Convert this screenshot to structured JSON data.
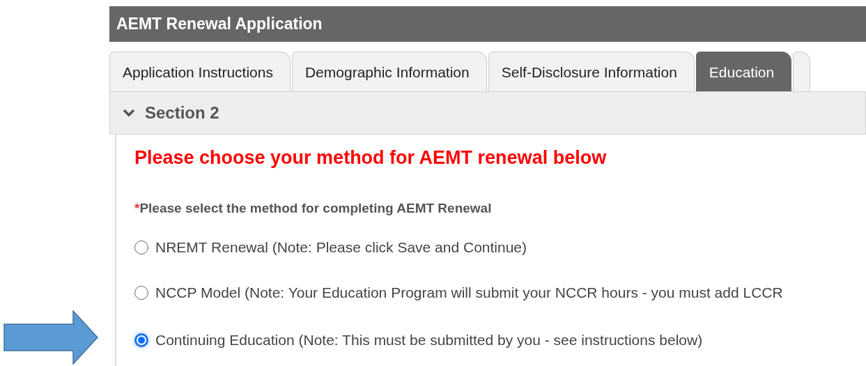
{
  "window": {
    "title": "AEMT Renewal Application"
  },
  "tabs": [
    {
      "label": "Application Instructions",
      "selected": false
    },
    {
      "label": "Demographic Information",
      "selected": false
    },
    {
      "label": "Self-Disclosure Information",
      "selected": false
    },
    {
      "label": "Education",
      "selected": true
    }
  ],
  "section": {
    "title": "Section 2",
    "expanded": true
  },
  "heading": "Please choose your method for AEMT renewal below",
  "question": {
    "required": true,
    "required_mark": "*",
    "label": "Please select the method for completing AEMT Renewal"
  },
  "options": [
    {
      "label": "NREMT Renewal (Note: Please click Save and Continue)",
      "selected": false
    },
    {
      "label": "NCCP Model (Note: Your Education Program will submit your NCCR hours - you must add LCCR",
      "selected": false
    },
    {
      "label": "Continuing Education (Note: This must be submitted by you - see instructions below)",
      "selected": true
    }
  ]
}
